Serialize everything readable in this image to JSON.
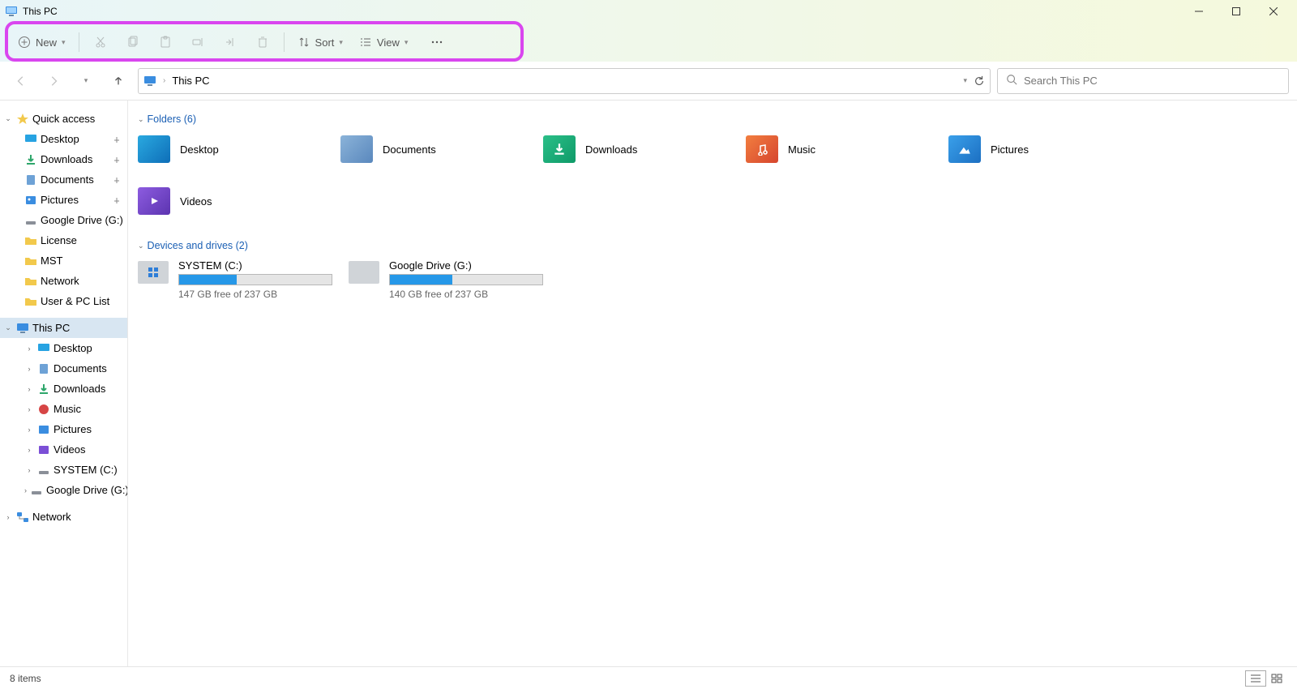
{
  "window": {
    "title": "This PC"
  },
  "toolbar": {
    "new_label": "New",
    "sort_label": "Sort",
    "view_label": "View"
  },
  "address": {
    "location": "This PC",
    "search_placeholder": "Search This PC"
  },
  "sidebar": {
    "quick_access": {
      "label": "Quick access",
      "items": [
        {
          "label": "Desktop",
          "pinned": true
        },
        {
          "label": "Downloads",
          "pinned": true
        },
        {
          "label": "Documents",
          "pinned": true
        },
        {
          "label": "Pictures",
          "pinned": true
        },
        {
          "label": "Google Drive (G:)",
          "pinned": true
        },
        {
          "label": "License",
          "pinned": false
        },
        {
          "label": "MST",
          "pinned": false
        },
        {
          "label": "Network",
          "pinned": false
        },
        {
          "label": "User & PC List",
          "pinned": false
        }
      ]
    },
    "this_pc": {
      "label": "This PC",
      "items": [
        {
          "label": "Desktop"
        },
        {
          "label": "Documents"
        },
        {
          "label": "Downloads"
        },
        {
          "label": "Music"
        },
        {
          "label": "Pictures"
        },
        {
          "label": "Videos"
        },
        {
          "label": "SYSTEM (C:)"
        },
        {
          "label": "Google Drive (G:)"
        }
      ]
    },
    "network": {
      "label": "Network"
    }
  },
  "content": {
    "folders_header": "Folders (6)",
    "folders": [
      {
        "label": "Desktop"
      },
      {
        "label": "Documents"
      },
      {
        "label": "Downloads"
      },
      {
        "label": "Music"
      },
      {
        "label": "Pictures"
      },
      {
        "label": "Videos"
      }
    ],
    "drives_header": "Devices and drives (2)",
    "drives": [
      {
        "label": "SYSTEM (C:)",
        "free_text": "147 GB free of 237 GB",
        "used_pct": 38
      },
      {
        "label": "Google Drive (G:)",
        "free_text": "140 GB free of 237 GB",
        "used_pct": 41
      }
    ]
  },
  "status": {
    "items_text": "8 items"
  }
}
